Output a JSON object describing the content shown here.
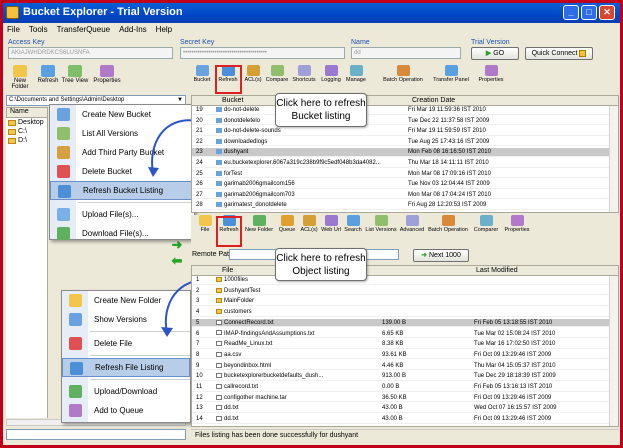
{
  "window": {
    "title": "Bucket Explorer - Trial Version",
    "controls": [
      "_",
      "□",
      "✕"
    ]
  },
  "menu": [
    "File",
    "Tools",
    "TransferQueue",
    "Add-Ins",
    "Help"
  ],
  "credentials": {
    "access_key_label": "Access Key",
    "access_key_value": "AKIAJWHDRDKCS6LUSNFA",
    "secret_key_label": "Secret Key",
    "secret_key_value": "••••••••••••••••••••••••••••••••••••••••",
    "name_label": "Name",
    "name_value": "dd",
    "trial_label": "Trial Version",
    "go_label": "GO",
    "quick_connect_label": "Quick Connect"
  },
  "left_toolbar": [
    "New Folder",
    "Refresh",
    "Tree View",
    "Properties"
  ],
  "local_path": "C:\\Documents and Settings\\Admin\\Desktop",
  "tree": {
    "header": "Name",
    "items": [
      "Desktop",
      "C:\\",
      "D:\\"
    ]
  },
  "bucket_menu": [
    {
      "label": "Create New Bucket",
      "icon": "create-bucket-icon"
    },
    {
      "label": "List All Versions",
      "icon": "versions-icon"
    },
    {
      "label": "Add Third Party Bucket",
      "icon": "third-party-icon"
    },
    {
      "label": "Delete Bucket",
      "icon": "delete-icon"
    },
    {
      "label": "Refresh Bucket Listing",
      "icon": "refresh-icon",
      "selected": true
    },
    {
      "label": "Upload File(s)...",
      "icon": "upload-icon"
    },
    {
      "label": "Download File(s)...",
      "icon": "download-icon"
    }
  ],
  "file_menu": [
    {
      "label": "Create New Folder",
      "icon": "new-folder-icon"
    },
    {
      "label": "Show Versions",
      "icon": "versions-icon"
    },
    {
      "label": "Delete File",
      "icon": "delete-icon"
    },
    {
      "label": "Refresh File Listing",
      "icon": "refresh-icon",
      "selected": true
    },
    {
      "label": "Upload/Download",
      "icon": "upload-icon"
    },
    {
      "label": "Add to Queue",
      "icon": "queue-icon"
    }
  ],
  "bucket_toolbar": [
    "Bucket",
    "Refresh",
    "ACL(s)",
    "Compare",
    "Shortcuts",
    "Logging",
    "Manage",
    "Batch Operation",
    "Transfer Panel",
    "Properties"
  ],
  "bucket_table": {
    "headers": [
      "Bucket",
      "Creation Date"
    ],
    "rows": [
      {
        "n": "19",
        "name": "do-not-delete",
        "date": "Fri Mar 19 11:59:36 IST 2010"
      },
      {
        "n": "20",
        "name": "donotdeletelo",
        "date": "Tue Dec 22 11:37:58 IST 2009"
      },
      {
        "n": "21",
        "name": "do-not-delete-sounds",
        "date": "Fri Mar 19 11:59:59 IST 2010"
      },
      {
        "n": "22",
        "name": "downloadedlogs",
        "date": "Tue Aug 25 17:43:16 IST 2009"
      },
      {
        "n": "23",
        "name": "dushyant",
        "date": "Mon Feb 08 16:16:50 IST 2010",
        "selected": true
      },
      {
        "n": "24",
        "name": "eu.bucketexplorer.6067a319c238b9f9c5edf048b3da4082...",
        "date": "Thu Mar 18 14:11:11 IST 2010"
      },
      {
        "n": "25",
        "name": "forTest",
        "date": "Mon Mar 08 17:09:16 IST 2010"
      },
      {
        "n": "26",
        "name": "garimab2006gmailcom156",
        "date": "Tue Nov 03 12:04:44 IST 2009"
      },
      {
        "n": "27",
        "name": "garimab2006gmailcom703",
        "date": "Mon Mar 08 17:04:24 IST 2010"
      },
      {
        "n": "28",
        "name": "garimatest_donotdelete",
        "date": "Fri Aug 28 12:20:53 IST 2009"
      }
    ]
  },
  "object_toolbar": [
    "File",
    "Refresh",
    "New Folder",
    "Queue",
    "ACL(s)",
    "Web Url",
    "Search",
    "List Versions",
    "Advanced",
    "Batch Operation",
    "Comparer",
    "Properties"
  ],
  "remote_path_label": "Remote Path:",
  "next_label": "Next 1000",
  "object_table": {
    "headers": [
      "File",
      "Last Modified"
    ],
    "rows": [
      {
        "n": "1",
        "name": "1000files",
        "size": "",
        "date": "",
        "kind": "folder"
      },
      {
        "n": "2",
        "name": "DushyantTest",
        "size": "",
        "date": "",
        "kind": "folder"
      },
      {
        "n": "3",
        "name": "MainFolder",
        "size": "",
        "date": "",
        "kind": "folder"
      },
      {
        "n": "4",
        "name": "customers",
        "size": "",
        "date": "",
        "kind": "folder"
      },
      {
        "n": "5",
        "name": "ConnectRecord.txt",
        "size": "139.00 B",
        "date": "Fri Feb 05 13:18:55 IST 2010",
        "kind": "file",
        "selected": true
      },
      {
        "n": "6",
        "name": "IMAP-findingsAndAssumptions.txt",
        "size": "6.65 KB",
        "date": "Tue Mar 02 15:08:24 IST 2010",
        "kind": "file"
      },
      {
        "n": "7",
        "name": "ReadMe_Linux.txt",
        "size": "8.38 KB",
        "date": "Tue Mar 16 17:02:50 IST 2010",
        "kind": "file"
      },
      {
        "n": "8",
        "name": "aa.csv",
        "size": "93.61 KB",
        "date": "Fri Oct 09 13:29:46 IST 2009",
        "kind": "file"
      },
      {
        "n": "9",
        "name": "beyondinbox.html",
        "size": "4.46 KB",
        "date": "Thu Mar 04 15:05:37 IST 2010",
        "kind": "file"
      },
      {
        "n": "10",
        "name": "bucketexplorerbucketdefaults_dush...",
        "size": "913.00 B",
        "date": "Tue Dec 29 18:18:39 IST 2009",
        "kind": "file"
      },
      {
        "n": "11",
        "name": "callrecord.txt",
        "size": "0.00 B",
        "date": "Fri Feb 05 13:16:13 IST 2010",
        "kind": "file"
      },
      {
        "n": "12",
        "name": "configother machine.tar",
        "size": "36.50 KB",
        "date": "Fri Oct 09 13:29:46 IST 2009",
        "kind": "file"
      },
      {
        "n": "13",
        "name": "dd.txt",
        "size": "43.00 B",
        "date": "Wed Oct 07 16:15:57 IST 2009",
        "kind": "file"
      },
      {
        "n": "14",
        "name": "dd.txt",
        "size": "43.00 B",
        "date": "Fri Oct 09 13:29:46 IST 2009",
        "kind": "file"
      }
    ]
  },
  "callouts": {
    "bucket": "Click here to refresh Bucket listing",
    "object": "Click here to refresh Object listing"
  },
  "status": "Files listing has been done successfully for dushyant",
  "colors": {
    "frame": "#c0001a",
    "titlebar": "#0046c8",
    "highlight": "#e02020",
    "selection": "#c9c9c9"
  }
}
